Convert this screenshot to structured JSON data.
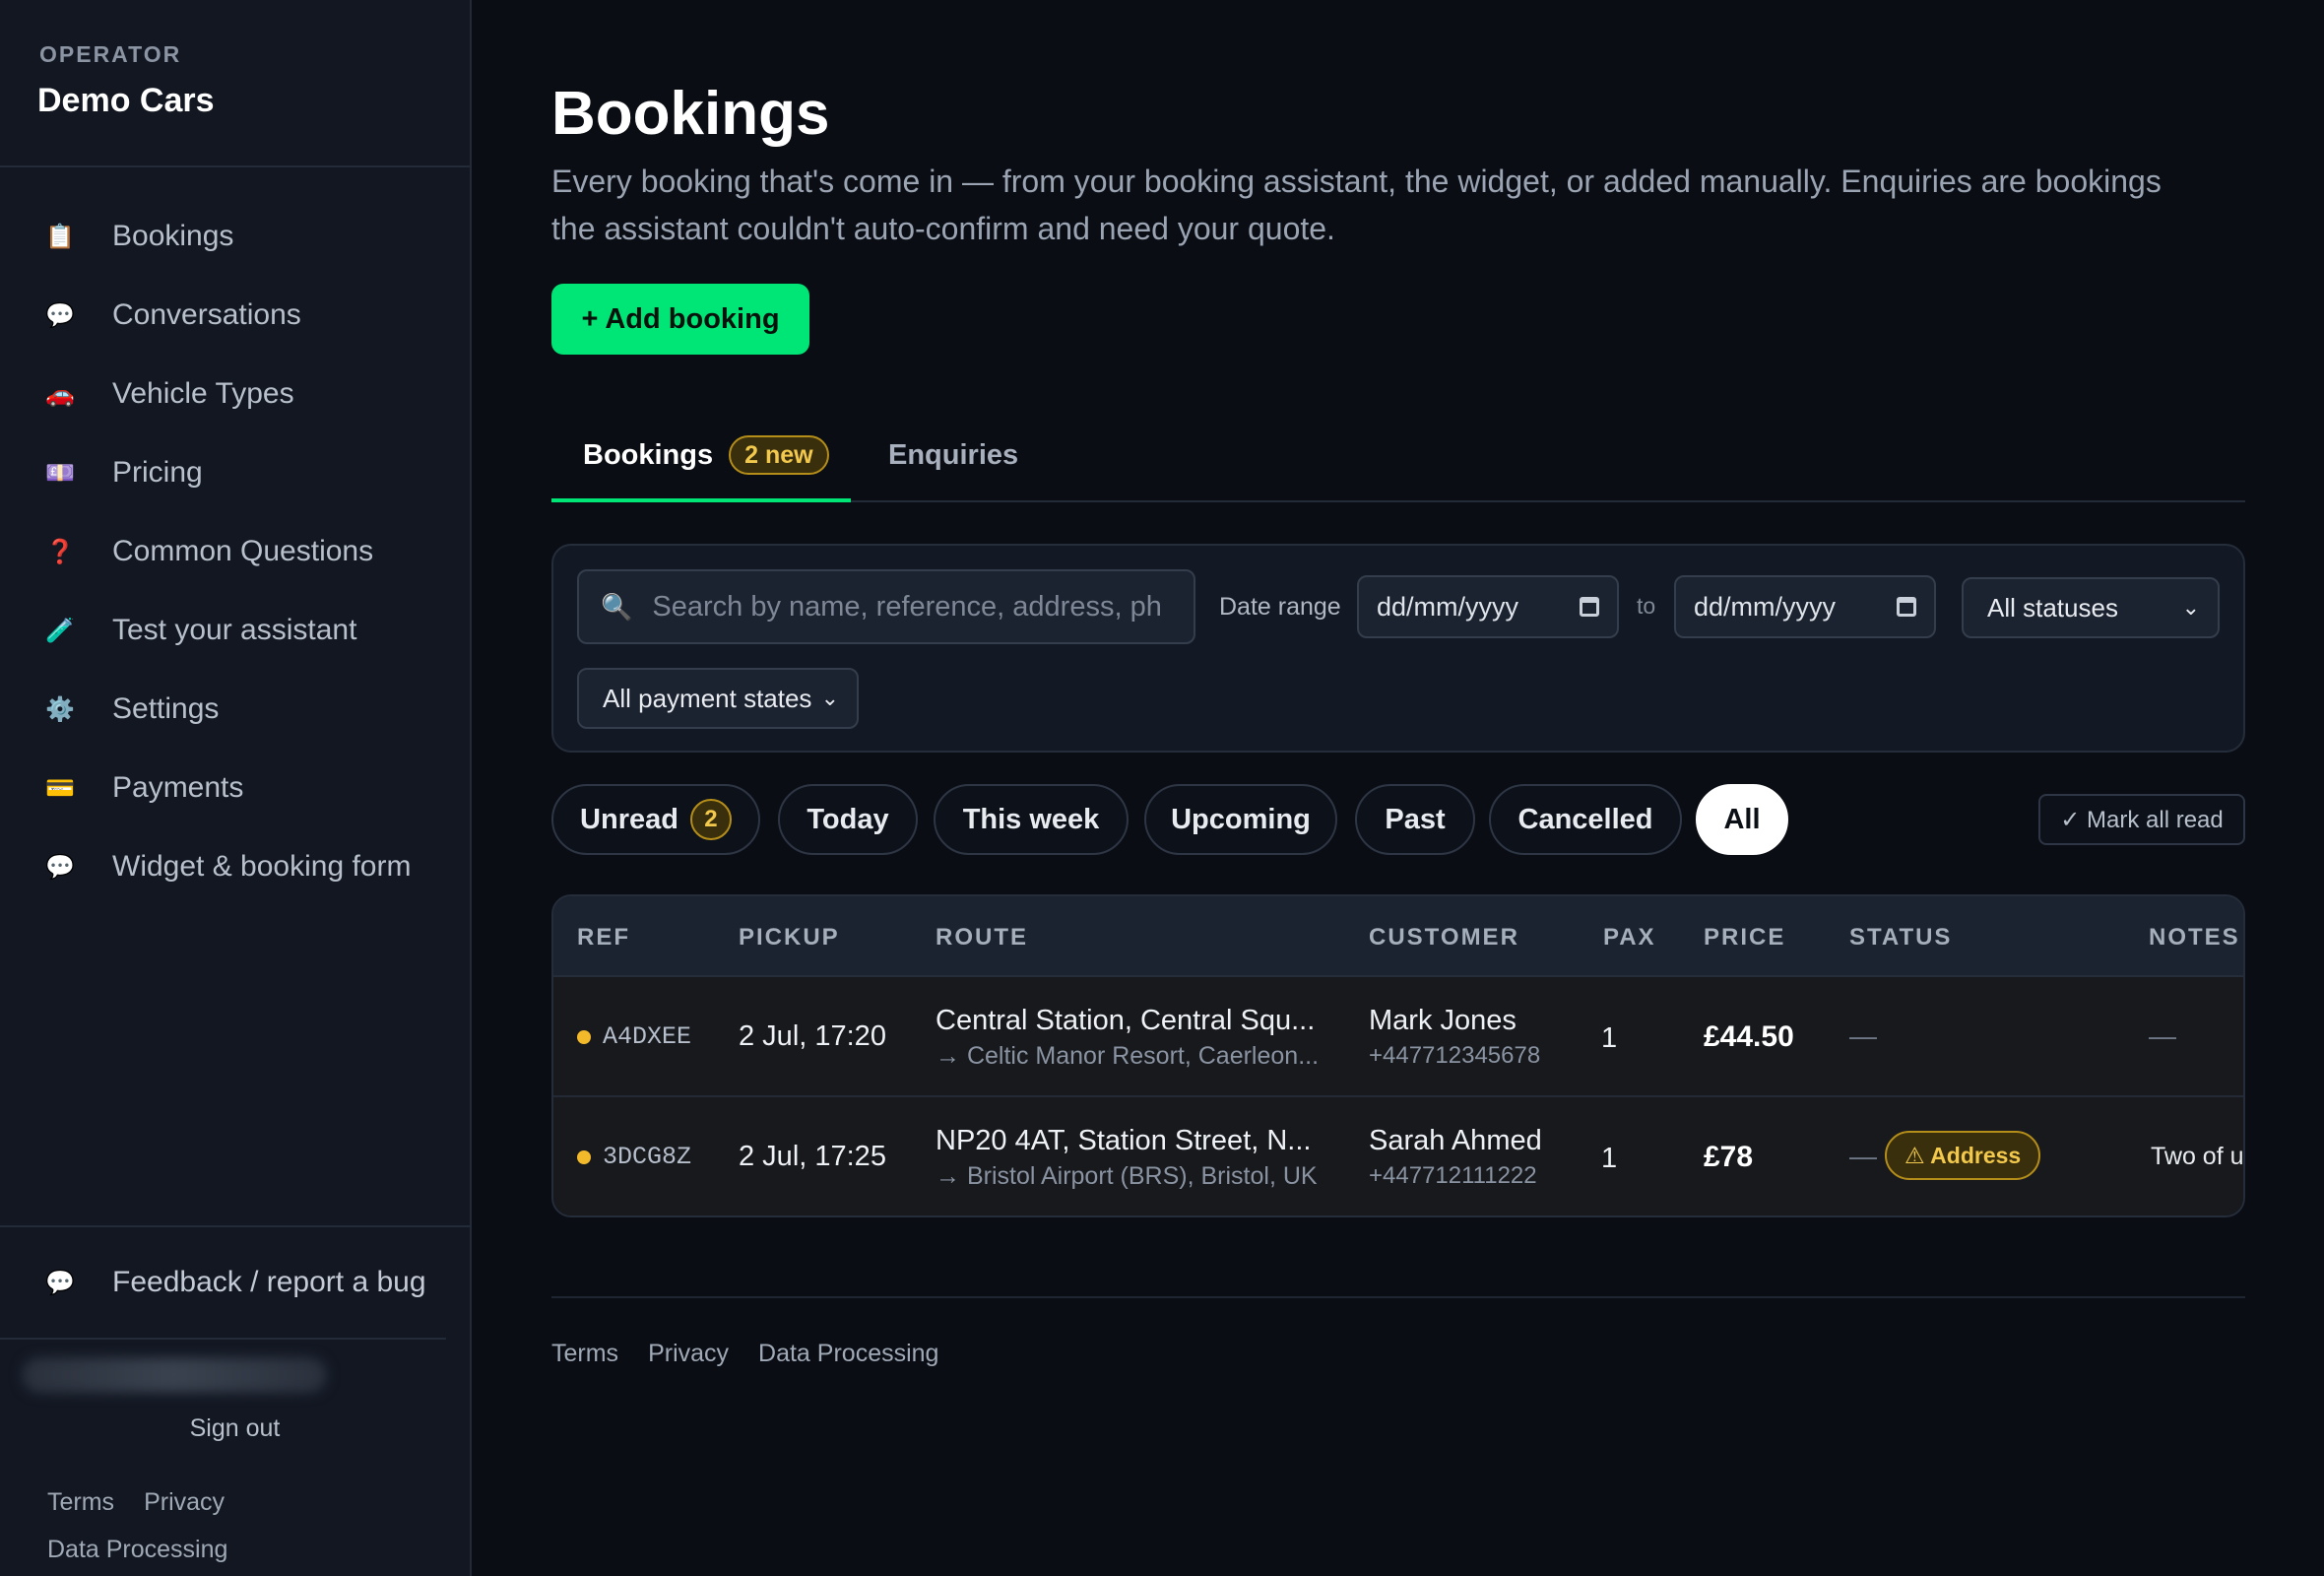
{
  "sidebar": {
    "operator_label": "OPERATOR",
    "company": "Demo Cars",
    "items": [
      {
        "label": "Bookings",
        "icon": "📋"
      },
      {
        "label": "Conversations",
        "icon": "💬"
      },
      {
        "label": "Vehicle Types",
        "icon": "🚗"
      },
      {
        "label": "Pricing",
        "icon": "💷"
      },
      {
        "label": "Common Questions",
        "icon": "❓"
      },
      {
        "label": "Test your assistant",
        "icon": "🧪"
      },
      {
        "label": "Settings",
        "icon": "⚙️"
      },
      {
        "label": "Payments",
        "icon": "💳"
      },
      {
        "label": "Widget & booking form",
        "icon": "💬"
      }
    ],
    "feedback": {
      "label": "Feedback / report a bug",
      "icon": "💬"
    },
    "sign_out": "Sign out",
    "legal": {
      "terms": "Terms",
      "privacy": "Privacy",
      "data_processing": "Data Processing"
    }
  },
  "main": {
    "title": "Bookings",
    "description": "Every booking that's come in — from your booking assistant, the widget, or added manually. Enquiries are bookings the assistant couldn't auto-confirm and need your quote.",
    "add_button": "+ Add booking",
    "tabs": [
      {
        "label": "Bookings",
        "badge": "2 new"
      },
      {
        "label": "Enquiries"
      }
    ],
    "filters": {
      "search_placeholder": "Search by name, reference, address, ph",
      "search_value": "",
      "date_range_label": "Date range",
      "date_from": "dd/mm/yyyy",
      "to_label": "to",
      "date_to": "dd/mm/yyyy",
      "status": "All statuses",
      "payment": "All payment states"
    },
    "chips": [
      {
        "label": "Unread",
        "count": "2"
      },
      {
        "label": "Today"
      },
      {
        "label": "This week"
      },
      {
        "label": "Upcoming"
      },
      {
        "label": "Past"
      },
      {
        "label": "Cancelled"
      },
      {
        "label": "All",
        "active": true
      }
    ],
    "mark_all_read": "✓ Mark all read",
    "table": {
      "columns": [
        "REF",
        "PICKUP",
        "ROUTE",
        "CUSTOMER",
        "PAX",
        "PRICE",
        "STATUS",
        "NOTES"
      ],
      "rows": [
        {
          "ref": "A4DXEE",
          "pickup": "2 Jul, 17:20",
          "route_from": "Central Station, Central Squ...",
          "route_to": "→ Celtic Manor Resort, Caerleon...",
          "customer": "Mark Jones",
          "phone": "+447712345678",
          "pax": "1",
          "price": "£44.50",
          "status": "—",
          "notes": "—"
        },
        {
          "ref": "3DCG8Z",
          "pickup": "2 Jul, 17:25",
          "route_from": "NP20 4AT, Station Street, N...",
          "route_to": "→ Bristol Airport (BRS), Bristol, UK",
          "customer": "Sarah Ahmed",
          "phone": "+447712111222",
          "pax": "1",
          "price": "£78",
          "status": "—",
          "status_badge": "⚠ Address",
          "notes": "Two of u"
        }
      ]
    },
    "footer": {
      "terms": "Terms",
      "privacy": "Privacy",
      "data_processing": "Data Processing"
    }
  },
  "colors": {
    "accent": "#00e676",
    "background": "#0a0d13",
    "sidebar": "#121722",
    "warning": "#f2c94c"
  }
}
